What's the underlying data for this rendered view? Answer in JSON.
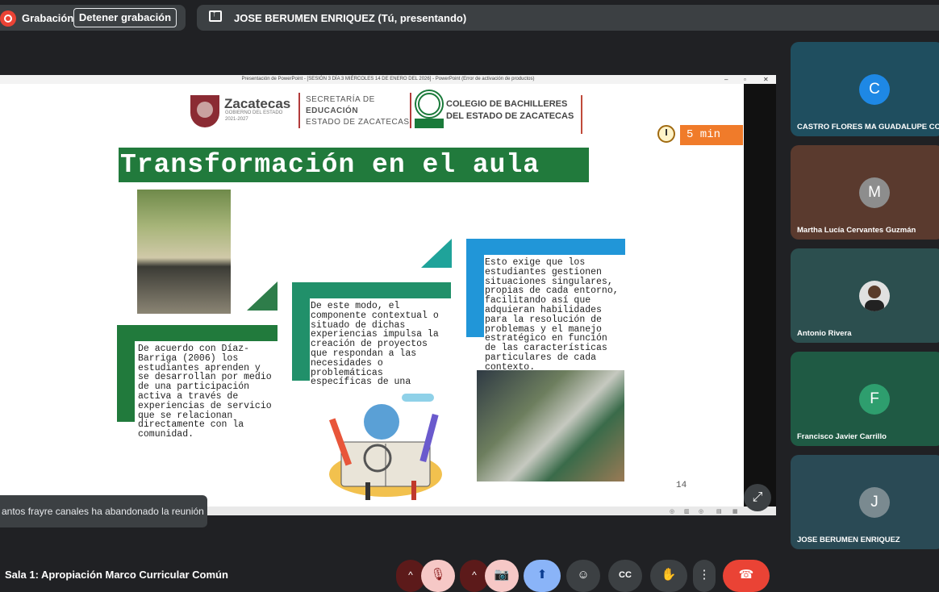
{
  "top_bar": {
    "recording_label": "Grabación",
    "stop_recording_label": "Detener grabación",
    "presenter_label": "JOSE BERUMEN ENRIQUEZ (Tú, presentando)"
  },
  "slide_window": {
    "title": "Presentación de PowerPoint - [SESIÓN 3 DÍA 3 MIÉRCOLES 14 DE ENERO DEL 2026] - PowerPoint (Error de activación de productos)",
    "controls": [
      "–",
      "▫",
      "✕"
    ]
  },
  "slide": {
    "logo_zacatecas": {
      "title": "Zacatecas",
      "sub1": "GOBIERNO DEL ESTADO",
      "sub2": "2021-2027"
    },
    "secretaria": [
      "SECRETARÍA DE",
      "EDUCACIÓN",
      "ESTADO DE ZACATECAS"
    ],
    "colegio": [
      "COLEGIO DE BACHILLERES",
      "DEL ESTADO DE ZACATECAS"
    ],
    "timer": "5 min",
    "title": "Transformación en el aula",
    "text_left": "De acuerdo con Díaz-\nBarriga (2006) los\nestudiantes aprenden y\nse desarrollan por medio\nde una participación\nactiva a través de\nexperiencias de servicio\nque se relacionan\ndirectamente con la\ncomunidad.",
    "text_middle": "De este modo, el\ncomponente contextual o\nsituado de dichas\nexperiencias impulsa la\ncreación de proyectos\nque respondan a las\nnecesidades o\nproblemáticas\nespecíficas de una",
    "text_right": "Esto exige que los\nestudiantes gestionen\nsituaciones singulares,\npropias de cada entorno,\nfacilitando así que\nadquieran habilidades\npara la resolución de\nproblemas y el manejo\nestratégico en función\nde las características\nparticulares de cada\ncontexto.",
    "page_number": "14"
  },
  "toast": "antos frayre canales ha abandonado la reunión",
  "participants": [
    {
      "initial": "C",
      "name": "CASTRO FLORES MA GUADALUPE CO",
      "bg": "#1f4e5f",
      "avatar_bg": "#1e88e5"
    },
    {
      "initial": "M",
      "name": "Martha Lucía Cervantes Guzmán",
      "bg": "#5a3a2e",
      "avatar_bg": "#8d8d8d"
    },
    {
      "initial": "",
      "name": "Antonio Rivera",
      "bg": "#2c4f4f",
      "avatar_bg": "#e0e0e0"
    },
    {
      "initial": "F",
      "name": "Francisco Javier Carrillo",
      "bg": "#1f5a44",
      "avatar_bg": "#2e9e6e"
    },
    {
      "initial": "J",
      "name": "JOSE BERUMEN ENRIQUEZ",
      "bg": "#2a4a55",
      "avatar_bg": "#7a8a90"
    }
  ],
  "meeting_name": "Sala 1: Apropiación Marco Curricular Común",
  "controls": {
    "chevron": "^",
    "mic": "🎙",
    "camera": "📷",
    "present": "⬆",
    "emoji": "☺",
    "captions": "CC",
    "hand": "✋",
    "more": "⋮",
    "hangup": "☎",
    "expand": "⤢"
  },
  "colors": {
    "accent_red": "#ea4335",
    "present_blue": "#8ab4f8",
    "slide_green": "#217a3c",
    "timer_orange": "#f07b2a"
  }
}
